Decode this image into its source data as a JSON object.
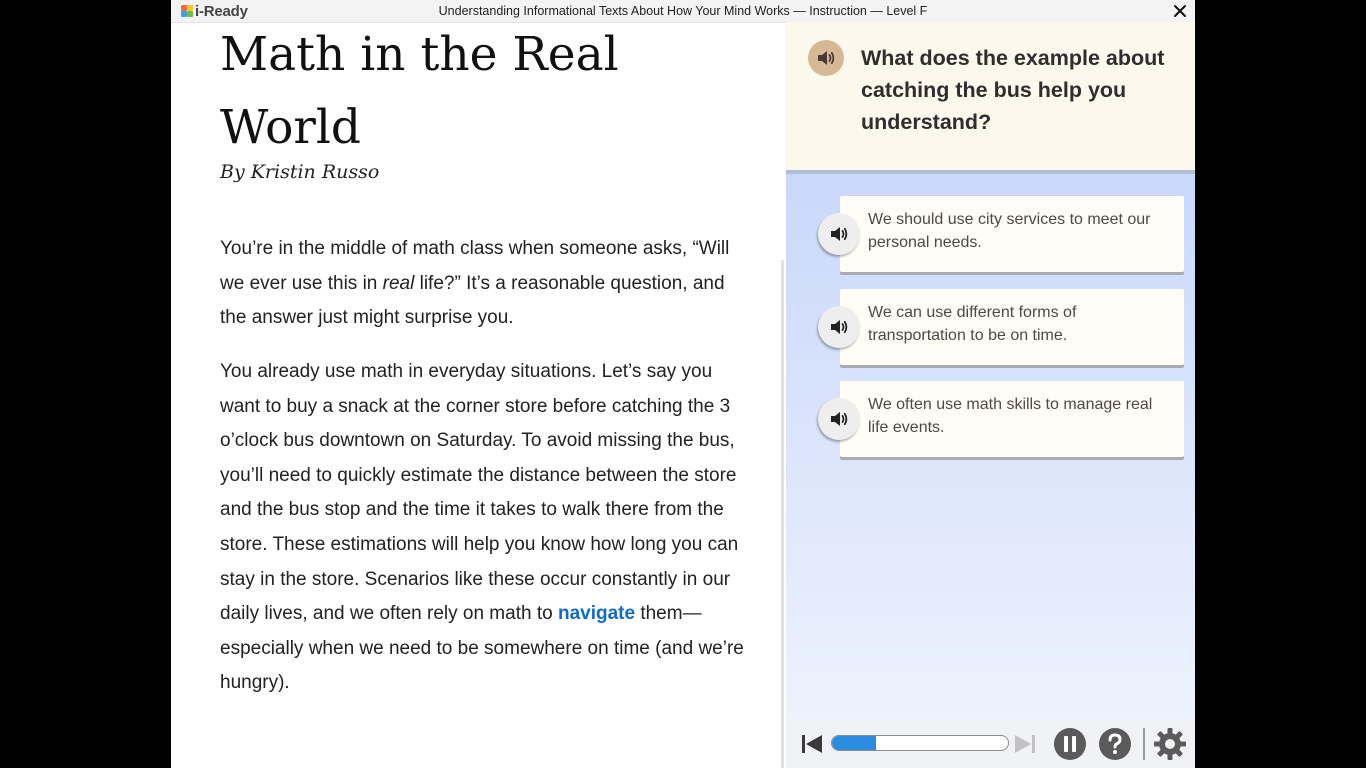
{
  "window": {
    "app_name": "i-Ready",
    "title": "Understanding Informational Texts About How Your Mind Works — Instruction — Level F",
    "close_icon": "close-icon"
  },
  "article": {
    "title": "Math in the Real World",
    "byline": "By Kristin Russo",
    "paragraph1": {
      "before_emphasis": "You’re in the middle of math class when someone asks, “Will we ever use this in ",
      "emphasis": "real",
      "after_emphasis": " life?” It’s a reasonable question, and the answer just might surprise you."
    },
    "paragraph2": {
      "before_link": "You already use math in everyday situations. Let’s say you want to buy a snack at the corner store before catching the 3 o’clock bus downtown on Saturday. To avoid missing the bus, you’ll need to quickly estimate the distance between the store and the bus stop and the time it takes to walk there from the store. These estimations will help you know how long you can stay in the store. Scenarios like these occur constantly in our daily lives, and we often rely on math to ",
      "link": "navigate",
      "after_link": " them—especially when we need to be somewhere on time (and we’re hungry)."
    }
  },
  "question": {
    "text": "What does the example about catching the bus help you understand?",
    "audio_icon": "speaker-icon"
  },
  "answers": [
    {
      "text": "We should use city services to meet our personal needs."
    },
    {
      "text": "We can use different forms of transportation to be on time."
    },
    {
      "text": "We often use math skills to manage real life events."
    }
  ],
  "controls": {
    "progress_fraction": 0.25,
    "icons": [
      "skip-back-icon",
      "skip-forward-icon",
      "pause-icon",
      "help-icon",
      "settings-icon"
    ]
  },
  "colors": {
    "link": "#0e6ccc",
    "progress": "#2a8ce0",
    "question_bg": "#fdf8ec",
    "answer_bg": "#fffdf6"
  }
}
